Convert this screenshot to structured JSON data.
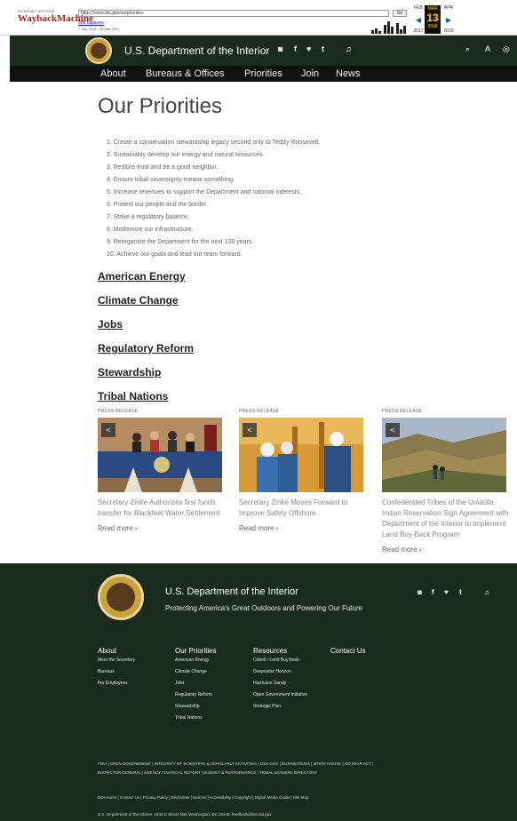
{
  "wayback": {
    "logo_small": "INTERNET ARCHIVE",
    "logo_big": "WaybackMachine",
    "url": "https://www.doi.gov/ourpriorities",
    "go": "Go",
    "captures": "506 captures",
    "range": "7 Sep 2016 - 26 Mar 2021",
    "months": {
      "prev": "FEB",
      "cur": "MAR",
      "next": "APR"
    },
    "day": "13",
    "years": {
      "prev": "2017",
      "cur": "2018",
      "next": "2019"
    }
  },
  "header": {
    "title": "U.S. Department of the Interior",
    "social": [
      "◙",
      "f",
      "♥",
      "t",
      "♫"
    ],
    "tools": [
      "⌕",
      "A",
      "◎"
    ]
  },
  "nav": [
    "About",
    "Bureaus & Offices",
    "Priorities",
    "Join",
    "News"
  ],
  "main": {
    "title": "Our Priorities",
    "priorities": [
      "1. Create a conservation stewardship legacy second only to Teddy Roosevelt.",
      "2. Sustainably develop our energy and natural resources.",
      "3. Restore trust and be a good neighbor.",
      "4. Ensure tribal sovereignty means something.",
      "5. Increase revenues to support the Department and national interests.",
      "6. Protect our people and the border.",
      "7. Strike a regulatory balance.",
      "8. Modernize our infrastructure.",
      "9. Reorganize the Department for the next 100 years.",
      "10. Achieve our goals and lead our team forward."
    ],
    "categories": [
      "American Energy",
      "Climate Change",
      "Jobs",
      "Regulatory Reform",
      "Stewardship",
      "Tribal Nations"
    ]
  },
  "cards": [
    {
      "label": "PRESS RELEASE",
      "title": "Secretary Zinke Authorizes first funds transfer for Blackfeet Water Settlement",
      "more": "Read more  ›"
    },
    {
      "label": "PRESS RELEASE",
      "title": "Secretary Zinke Moves Forward to Improve Safety Offshore",
      "more": "Read more  ›"
    },
    {
      "label": "PRESS RELEASE",
      "title": "Confederated Tribes of the Umatilla Indian Reservation Sign Agreement with Department of the Interior to Implement Land Buy-Back Program",
      "more": "Read more  ›"
    }
  ],
  "footer": {
    "title": "U.S. Department of the Interior",
    "tagline": "Protecting America's Great Outdoors and Powering Our Future",
    "social": [
      "◙",
      "f",
      "♥",
      "t",
      "♫"
    ],
    "columns": [
      {
        "heading": "About",
        "links": [
          "Meet the Secretary",
          "Bureaus",
          "For Employees"
        ]
      },
      {
        "heading": "Our Priorities",
        "links": [
          "American Energy",
          "Climate Change",
          "Jobs",
          "Regulatory Reform",
          "Stewardship",
          "Tribal Nations"
        ]
      },
      {
        "heading": "Resources",
        "links": [
          "Cobell / Land Buy-back",
          "Deepwater Horizon",
          "Hurricane Sandy",
          "Open Government Initiative",
          "Strategic Plan"
        ]
      },
      {
        "heading": "Contact Us",
        "links": []
      }
    ],
    "line1": "FOIA  |  OPEN GOVERNMENT  |  INTEGRITY OF SCIENTIFIC & SCHOLARLY ACTIVITIES  |  USA.GOV  |  BUSINESSUSA  |  WHITE HOUSE  |  NO FEAR ACT  |",
    "line2": "INSPECTOR GENERAL  |  AGENCY FINANCIAL REPORT  |  BUDGET & PERFORMANCE  |  TRIBAL LEADERS DIRECTORY",
    "line3": "DOI Home  |  Contact Us  |  Privacy Policy  |  Disclaimer  |  Notices  |  Accessibility  |  Copyright  |  Digital Media Guide  |  Site Map",
    "line4": "U.S. Department of the Interior, 1849 C Street NW, Washington, DC 20240. feedback@ios.doi.gov"
  }
}
